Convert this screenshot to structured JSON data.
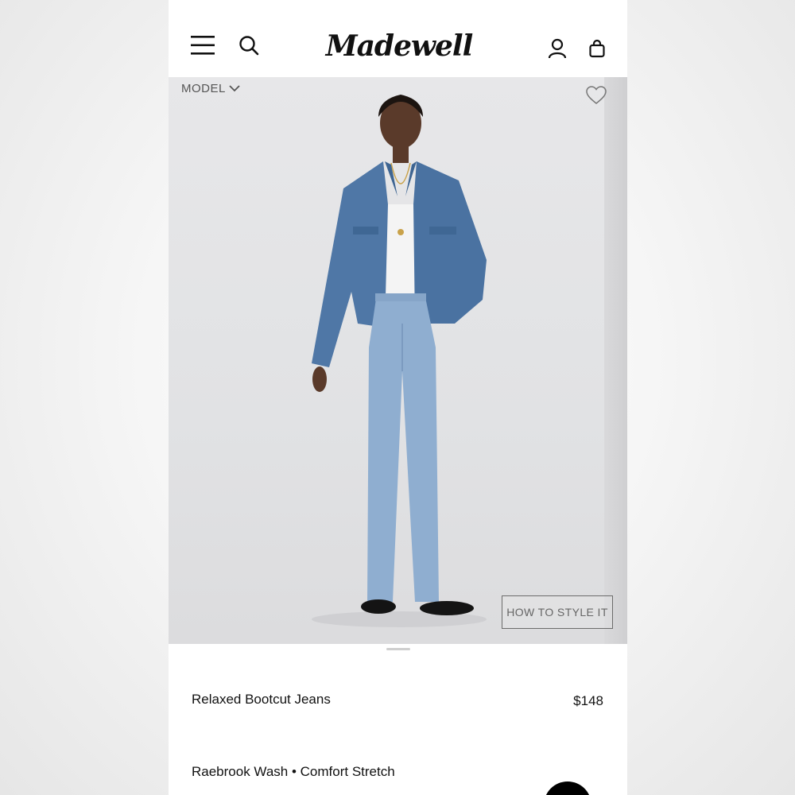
{
  "header": {
    "logo_text": "Madewell",
    "icons": [
      "menu-icon",
      "search-icon",
      "account-icon",
      "bag-icon"
    ]
  },
  "hero": {
    "model_label": "MODEL",
    "style_button_label": "HOW TO STYLE IT",
    "icons": [
      "chevron-down-icon",
      "heart-icon"
    ]
  },
  "product": {
    "name": "Relaxed Bootcut Jeans",
    "price": "$148",
    "variant": "Raebrook Wash • Comfort Stretch"
  },
  "colors": {
    "background": "#ffffff",
    "text": "#111111",
    "muted_text": "#666666",
    "image_bg": "#e3e3e5",
    "denim": "#8faed0"
  }
}
